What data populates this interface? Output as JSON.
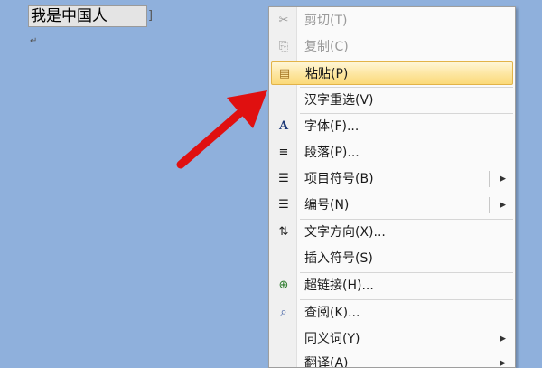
{
  "document": {
    "text": "我是中国人",
    "bracket_left": "[",
    "bracket_right": "]",
    "paragraph_mark": "↵"
  },
  "menu": {
    "items": [
      {
        "label": "剪切(T)",
        "icon": "scissors-icon",
        "glyph": "✂",
        "disabled": true
      },
      {
        "label": "复制(C)",
        "icon": "copy-icon",
        "glyph": "⎘",
        "disabled": true
      },
      {
        "label": "粘贴(P)",
        "icon": "clipboard-icon",
        "glyph": "📋",
        "highlight": true
      },
      {
        "label": "汉字重选(V)"
      },
      {
        "label": "字体(F)...",
        "icon": "font-icon",
        "glyph": "A"
      },
      {
        "label": "段落(P)...",
        "icon": "paragraph-icon",
        "glyph": "≡"
      },
      {
        "label": "项目符号(B)",
        "icon": "bullets-icon",
        "glyph": "☰",
        "submenu": true
      },
      {
        "label": "编号(N)",
        "icon": "numbering-icon",
        "glyph": "☰",
        "submenu": true
      },
      {
        "label": "文字方向(X)...",
        "icon": "text-direction-icon",
        "glyph": "⇅"
      },
      {
        "label": "插入符号(S)"
      },
      {
        "label": "超链接(H)...",
        "icon": "hyperlink-icon",
        "glyph": "🔗"
      },
      {
        "label": "查阅(K)...",
        "icon": "research-icon",
        "glyph": "🔍"
      },
      {
        "label": "同义词(Y)",
        "submenu": true
      },
      {
        "label": "翻译(A)",
        "submenu": true
      }
    ],
    "submenu_arrow": "▶"
  },
  "colors": {
    "background": "#8fb0dc",
    "arrow": "#e01010",
    "highlight": "#fde7a4"
  }
}
